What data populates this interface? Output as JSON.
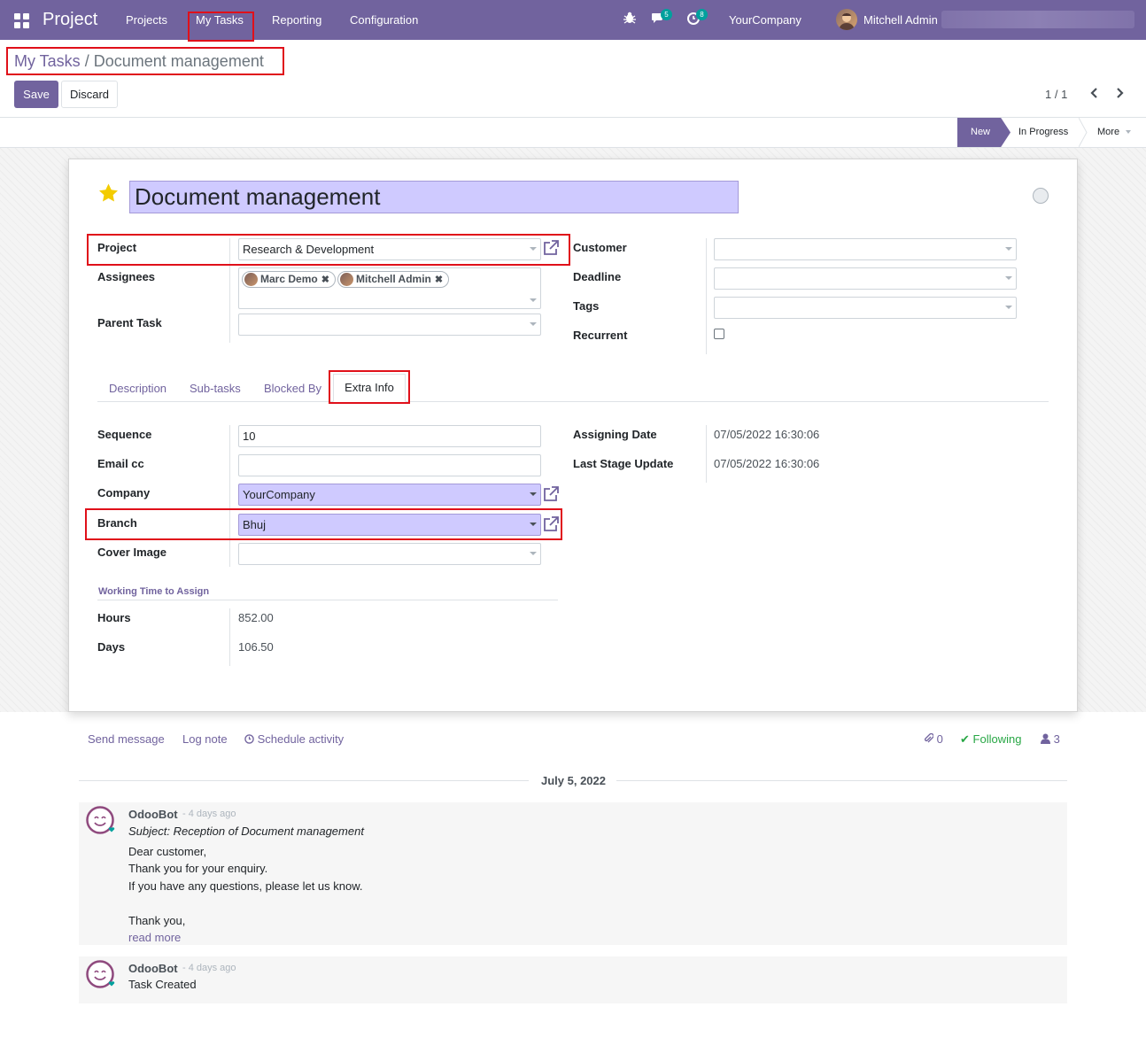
{
  "navbar": {
    "brand": "Project",
    "menu": [
      "Projects",
      "My Tasks",
      "Reporting",
      "Configuration"
    ],
    "chat_count": "5",
    "activity_count": "8",
    "company": "YourCompany",
    "user": "Mitchell Admin"
  },
  "breadcrumb": {
    "parent": "My Tasks",
    "separator": "/",
    "current": "Document management"
  },
  "buttons": {
    "save": "Save",
    "discard": "Discard"
  },
  "pager": {
    "text": "1 / 1"
  },
  "stages": {
    "active": "New",
    "next": "In Progress",
    "more": "More"
  },
  "task": {
    "title": "Document management"
  },
  "fields": {
    "project_label": "Project",
    "project_value": "Research & Development",
    "assignees_label": "Assignees",
    "assignees": [
      "Marc Demo",
      "Mitchell Admin"
    ],
    "parent_label": "Parent Task",
    "customer_label": "Customer",
    "deadline_label": "Deadline",
    "tags_label": "Tags",
    "recurrent_label": "Recurrent"
  },
  "tabs": [
    "Description",
    "Sub-tasks",
    "Blocked By",
    "Extra Info"
  ],
  "extra": {
    "sequence_label": "Sequence",
    "sequence_value": "10",
    "email_label": "Email cc",
    "company_label": "Company",
    "company_value": "YourCompany",
    "branch_label": "Branch",
    "branch_value": "Bhuj",
    "cover_label": "Cover Image",
    "assign_date_label": "Assigning Date",
    "assign_date_value": "07/05/2022 16:30:06",
    "stage_update_label": "Last Stage Update",
    "stage_update_value": "07/05/2022 16:30:06",
    "working_title": "Working Time to Assign",
    "hours_label": "Hours",
    "hours_value": "852.00",
    "days_label": "Days",
    "days_value": "106.50"
  },
  "chatter": {
    "send_message": "Send message",
    "log_note": "Log note",
    "schedule_activity": "Schedule activity",
    "attachments": "0",
    "following": "Following",
    "followers": "3",
    "date": "July 5, 2022",
    "messages": [
      {
        "author": "OdooBot",
        "ago": "- 4 days ago",
        "subject": "Subject: Reception of Document management",
        "lines": [
          "Dear customer,",
          "Thank you for your enquiry.",
          "If you have any questions, please let us know.",
          "",
          "Thank you,"
        ],
        "read_more": "read more"
      },
      {
        "author": "OdooBot",
        "ago": "- 4 days ago",
        "body": "Task Created"
      }
    ]
  },
  "colors": {
    "brand": "#71639e",
    "highlight": "#cfcaff",
    "annotation": "#e0101a",
    "following": "#28a745"
  }
}
